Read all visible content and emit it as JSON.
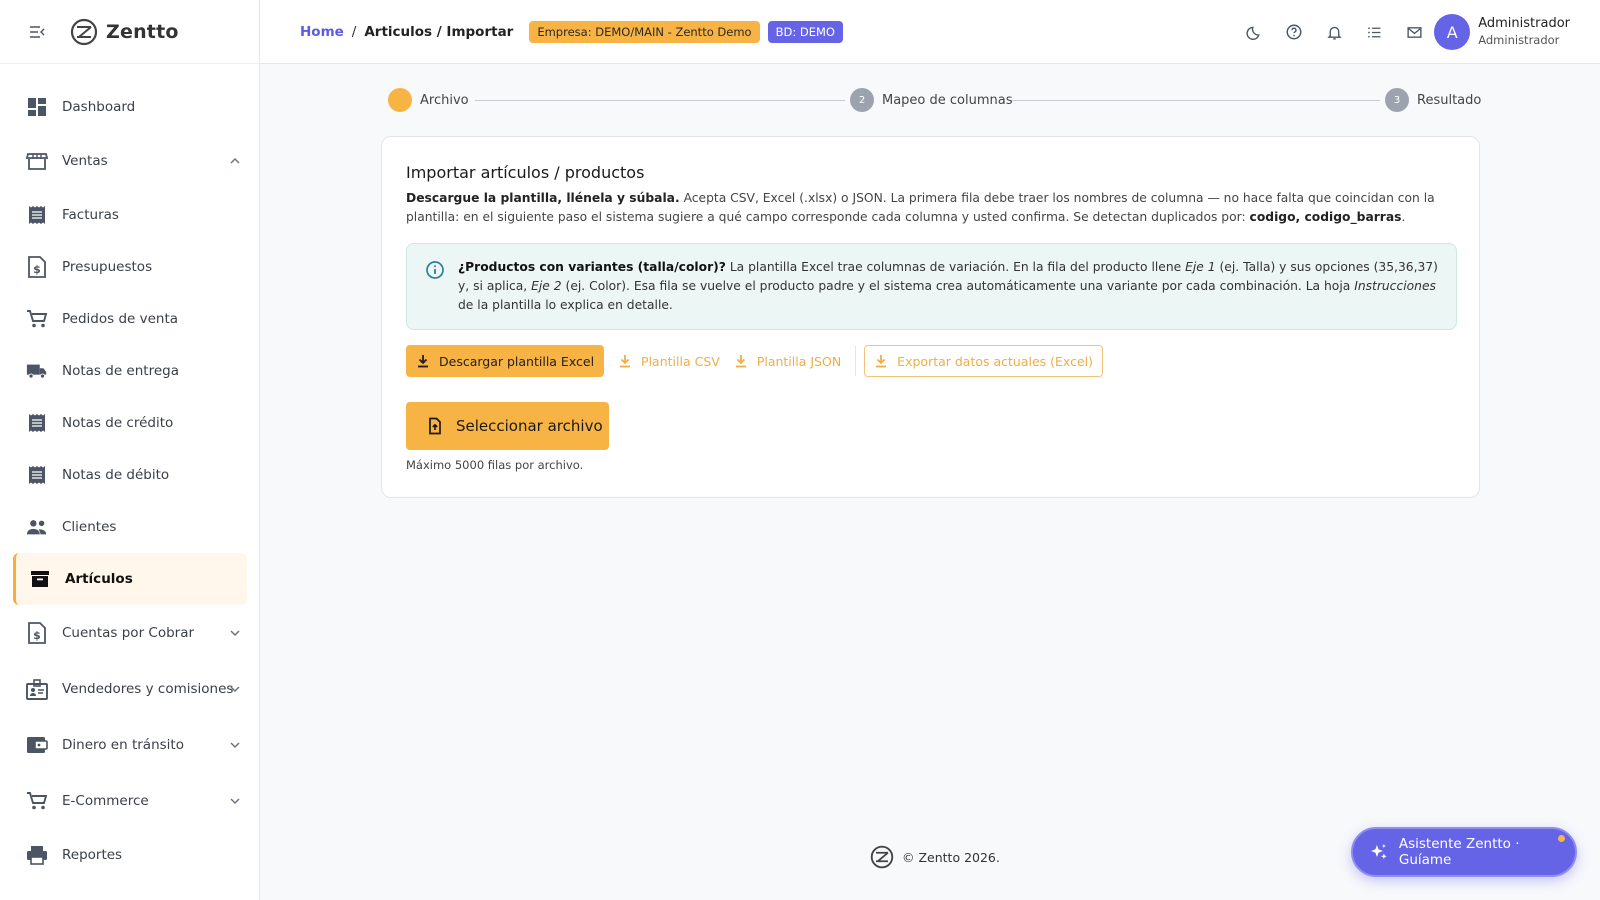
{
  "app": {
    "name": "Zentto"
  },
  "sidebar": {
    "items": [
      {
        "label": "Dashboard",
        "icon": "dashboard-icon",
        "expandable": false
      },
      {
        "label": "Ventas",
        "icon": "store-icon",
        "expandable": true,
        "expanded": true
      },
      {
        "label": "Facturas",
        "icon": "receipt-icon",
        "expandable": false
      },
      {
        "label": "Presupuestos",
        "icon": "dollar-file-icon",
        "expandable": false
      },
      {
        "label": "Pedidos de venta",
        "icon": "cart-icon",
        "expandable": false
      },
      {
        "label": "Notas de entrega",
        "icon": "truck-icon",
        "expandable": false
      },
      {
        "label": "Notas de crédito",
        "icon": "receipt-icon",
        "expandable": false
      },
      {
        "label": "Notas de débito",
        "icon": "receipt-icon",
        "expandable": false
      },
      {
        "label": "Clientes",
        "icon": "people-icon",
        "expandable": false
      },
      {
        "label": "Artículos",
        "icon": "archive-icon",
        "expandable": false,
        "active": true
      },
      {
        "label": "Cuentas por Cobrar",
        "icon": "dollar-file-icon",
        "expandable": true
      },
      {
        "label": "Vendedores y comisiones",
        "icon": "badge-icon",
        "expandable": true
      },
      {
        "label": "Dinero en tránsito",
        "icon": "wallet-icon",
        "expandable": true
      },
      {
        "label": "E-Commerce",
        "icon": "cart-icon",
        "expandable": true
      },
      {
        "label": "Reportes",
        "icon": "printer-icon",
        "expandable": false
      }
    ]
  },
  "topbar": {
    "breadcrumb": {
      "home": "Home",
      "separator": "/",
      "current": "Articulos / Importar"
    },
    "badge_empresa": "Empresa: DEMO/MAIN - Zentto Demo",
    "badge_bd": "BD: DEMO",
    "icons": [
      "moon-icon",
      "help-icon",
      "bell-icon",
      "list-icon",
      "mail-icon"
    ],
    "user": {
      "initial": "A",
      "name": "Administrador",
      "role": "Administrador"
    }
  },
  "stepper": {
    "steps": [
      {
        "number": "",
        "label": "Archivo",
        "active": true
      },
      {
        "number": "2",
        "label": "Mapeo de columnas",
        "active": false
      },
      {
        "number": "3",
        "label": "Resultado",
        "active": false
      }
    ]
  },
  "card": {
    "title": "Importar artículos / productos",
    "desc_bold": "Descargue la plantilla, llénela y súbala.",
    "desc_text": " Acepta CSV, Excel (.xlsx) o JSON. La primera fila debe traer los nombres de columna — no hace falta que coincidan con la plantilla: en el siguiente paso el sistema sugiere a qué campo corresponde cada columna y usted confirma. Se detectan duplicados por: ",
    "desc_dup_fields": "codigo, codigo_barras",
    "desc_end": ".",
    "info": {
      "bold": "¿Productos con variantes (talla/color)?",
      "t1": " La plantilla Excel trae columnas de variación. En la fila del producto llene ",
      "eje1": "Eje 1",
      "t2": " (ej. Talla) y sus opciones (35,36,37) y, si aplica, ",
      "eje2": "Eje 2",
      "t3": " (ej. Color). Esa fila se vuelve el producto padre y el sistema crea automáticamente una variante por cada combinación. La hoja ",
      "instr": "Instrucciones",
      "t4": " de la plantilla lo explica en detalle."
    },
    "buttons": {
      "excel": "Descargar plantilla Excel",
      "csv": "Plantilla CSV",
      "json": "Plantilla JSON",
      "export": "Exportar datos actuales (Excel)"
    },
    "select_file": "Seleccionar archivo",
    "max_note": "Máximo 5000 filas por archivo."
  },
  "footer": {
    "text": "© Zentto 2026."
  },
  "assistant": {
    "label": "Asistente Zentto · Guíame"
  },
  "colors": {
    "accent": "#f7b344",
    "brand": "#6563e6"
  }
}
